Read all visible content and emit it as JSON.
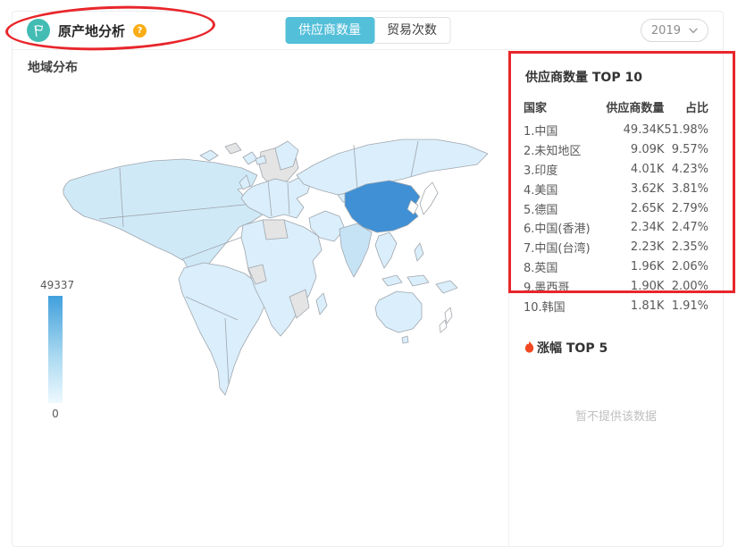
{
  "header": {
    "title": "原产地分析",
    "help": "?",
    "tabs": [
      {
        "label": "供应商数量",
        "active": true
      },
      {
        "label": "贸易次数",
        "active": false
      }
    ],
    "year": "2019"
  },
  "map_section": {
    "title": "地域分布",
    "legend_max": "49337",
    "legend_min": "0"
  },
  "top10": {
    "title": "供应商数量 TOP 10",
    "columns": [
      "国家",
      "供应商数量",
      "占比"
    ],
    "rows": [
      {
        "country": "1.中国",
        "value": "49.34K",
        "pct": "51.98%"
      },
      {
        "country": "2.未知地区",
        "value": "9.09K",
        "pct": "9.57%"
      },
      {
        "country": "3.印度",
        "value": "4.01K",
        "pct": "4.23%"
      },
      {
        "country": "4.美国",
        "value": "3.62K",
        "pct": "3.81%"
      },
      {
        "country": "5.德国",
        "value": "2.65K",
        "pct": "2.79%"
      },
      {
        "country": "6.中国(香港)",
        "value": "2.34K",
        "pct": "2.47%"
      },
      {
        "country": "7.中国(台湾)",
        "value": "2.23K",
        "pct": "2.35%"
      },
      {
        "country": "8.英国",
        "value": "1.96K",
        "pct": "2.06%"
      },
      {
        "country": "9.墨西哥",
        "value": "1.90K",
        "pct": "2.00%"
      },
      {
        "country": "10.韩国",
        "value": "1.81K",
        "pct": "1.91%"
      }
    ]
  },
  "rise": {
    "title": "涨幅 TOP 5",
    "empty_text": "暂不提供该数据"
  },
  "colors": {
    "accent_teal": "#43bcb4",
    "tab_active_blue": "#54bfd9",
    "help_badge_orange": "#faad14",
    "annotation_red": "#e8262b",
    "map_default_fill": "#daeefb",
    "map_nodata_fill": "#e4e4e4",
    "map_china_fill": "#3f90d5",
    "legend_gradient_top": "#41a0dc",
    "legend_gradient_bottom": "#eef9ff",
    "flame_red": "#f14823"
  },
  "chart_data": [
    {
      "type": "heatmap",
      "subtype": "world-choropleth",
      "title": "地域分布",
      "value_label": "供应商数量",
      "color_scale": {
        "min": 0,
        "max": 49337,
        "min_color": "#eef9ff",
        "max_color": "#41a0dc"
      },
      "highlight": {
        "region": "中国",
        "fill": "#3f90d5",
        "value": 49337
      },
      "nodata_regions_fill": "#e4e4e4"
    },
    {
      "type": "table",
      "title": "供应商数量 TOP 10",
      "columns": [
        "国家",
        "供应商数量",
        "占比"
      ],
      "rows": [
        [
          "1.中国",
          "49.34K",
          "51.98%"
        ],
        [
          "2.未知地区",
          "9.09K",
          "9.57%"
        ],
        [
          "3.印度",
          "4.01K",
          "4.23%"
        ],
        [
          "4.美国",
          "3.62K",
          "3.81%"
        ],
        [
          "5.德国",
          "2.65K",
          "2.79%"
        ],
        [
          "6.中国(香港)",
          "2.34K",
          "2.47%"
        ],
        [
          "7.中国(台湾)",
          "2.23K",
          "2.35%"
        ],
        [
          "8.英国",
          "1.96K",
          "2.06%"
        ],
        [
          "9.墨西哥",
          "1.90K",
          "2.00%"
        ],
        [
          "10.韩国",
          "1.81K",
          "1.91%"
        ]
      ]
    }
  ]
}
